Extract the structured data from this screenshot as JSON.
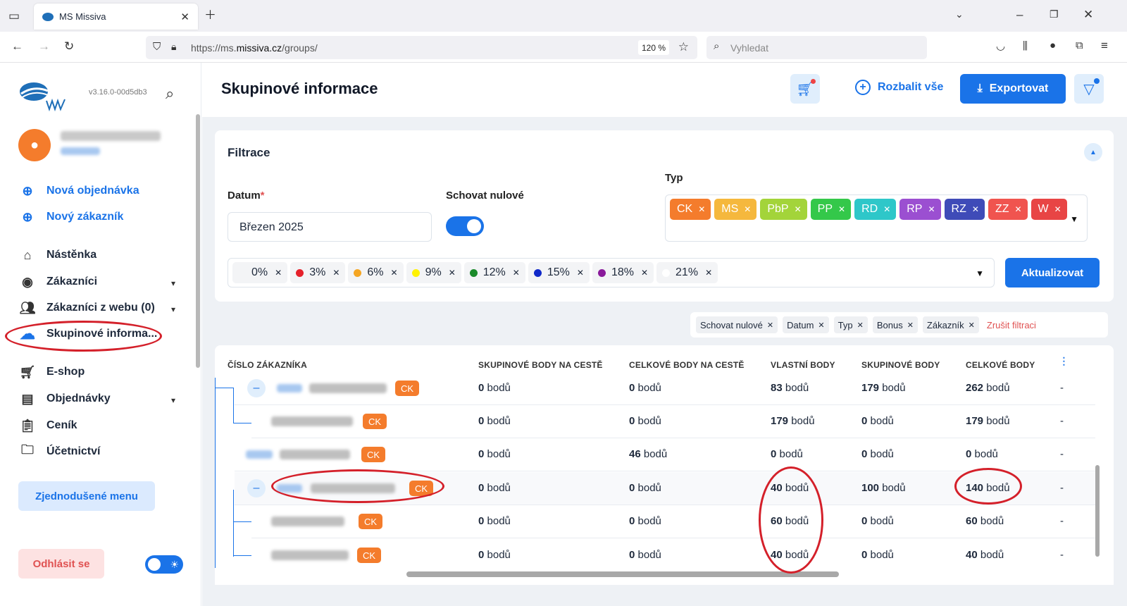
{
  "browser": {
    "tab_title": "MS Missiva",
    "url_prefix": "https://ms.",
    "url_domain": "missiva.cz",
    "url_path": "/groups/",
    "zoom": "120 %",
    "search_placeholder": "Vyhledat"
  },
  "sidebar": {
    "version": "v3.16.0-00d5db3",
    "new_order": "Nová objednávka",
    "new_customer": "Nový zákazník",
    "items": [
      {
        "label": "Nástěnka",
        "icon": "home-icon",
        "expandable": false
      },
      {
        "label": "Zákazníci",
        "icon": "user-icon",
        "expandable": true
      },
      {
        "label": "Zákazníci z webu (0)",
        "icon": "users-icon",
        "expandable": true
      },
      {
        "label": "Skupinové informa...",
        "icon": "tree-icon",
        "expandable": false,
        "active": true
      },
      {
        "label": "E-shop",
        "icon": "cart-icon",
        "expandable": false
      },
      {
        "label": "Objednávky",
        "icon": "document-icon",
        "expandable": true
      },
      {
        "label": "Ceník",
        "icon": "clipboard-icon",
        "expandable": false
      },
      {
        "label": "Účetnictví",
        "icon": "folder-icon",
        "expandable": false
      }
    ],
    "simple_menu": "Zjednodušené menu",
    "logout": "Odhlásit se"
  },
  "header": {
    "title": "Skupinové informace",
    "expand_all": "Rozbalit vše",
    "export": "Exportovat"
  },
  "filters": {
    "title": "Filtrace",
    "date_label": "Datum",
    "date_required": "*",
    "date_value": "Březen 2025",
    "hide_zero_label": "Schovat nulové",
    "type_label": "Typ",
    "types": [
      {
        "label": "CK",
        "color": "#f47c2c"
      },
      {
        "label": "MS",
        "color": "#f5b83d"
      },
      {
        "label": "PbP",
        "color": "#a3d43a"
      },
      {
        "label": "PP",
        "color": "#34c84a"
      },
      {
        "label": "RD",
        "color": "#2ec7c9"
      },
      {
        "label": "RP",
        "color": "#9b4fd1"
      },
      {
        "label": "RZ",
        "color": "#3f4bb8"
      },
      {
        "label": "ZZ",
        "color": "#f0544f"
      },
      {
        "label": "W",
        "color": "#e84545"
      }
    ],
    "bonuses": [
      {
        "label": "0%",
        "color": "#f3f4f6"
      },
      {
        "label": "3%",
        "color": "#e5212b"
      },
      {
        "label": "6%",
        "color": "#f5a623"
      },
      {
        "label": "9%",
        "color": "#fff200"
      },
      {
        "label": "12%",
        "color": "#1a8a2a"
      },
      {
        "label": "15%",
        "color": "#1029c9"
      },
      {
        "label": "18%",
        "color": "#8a1a9b"
      },
      {
        "label": "21%",
        "color": "#ffffff"
      }
    ],
    "update": "Aktualizovat",
    "active": [
      "Schovat nulové",
      "Datum",
      "Typ",
      "Bonus",
      "Zákazník"
    ],
    "clear": "Zrušit filtraci"
  },
  "table": {
    "columns": [
      "ČÍSLO ZÁKAZNÍKA",
      "SKUPINOVÉ BODY NA CESTĚ",
      "CELKOVÉ BODY NA CESTĚ",
      "VLASTNÍ BODY",
      "SKUPINOVÉ BODY",
      "CELKOVÉ BODY"
    ],
    "unit": "bodů",
    "rows": [
      {
        "type": "CK",
        "group_transit": "0",
        "total_transit": "0",
        "own": "83",
        "group": "179",
        "total": "262",
        "extra": "-"
      },
      {
        "type": "CK",
        "group_transit": "0",
        "total_transit": "0",
        "own": "179",
        "group": "0",
        "total": "179",
        "extra": "-"
      },
      {
        "type": "CK",
        "group_transit": "0",
        "total_transit": "46",
        "own": "0",
        "group": "0",
        "total": "0",
        "extra": "-"
      },
      {
        "type": "CK",
        "group_transit": "0",
        "total_transit": "0",
        "own": "40",
        "group": "100",
        "total": "140",
        "extra": "-"
      },
      {
        "type": "CK",
        "group_transit": "0",
        "total_transit": "0",
        "own": "60",
        "group": "0",
        "total": "60",
        "extra": "-"
      },
      {
        "type": "CK",
        "group_transit": "0",
        "total_transit": "0",
        "own": "40",
        "group": "0",
        "total": "40",
        "extra": "-"
      }
    ]
  }
}
